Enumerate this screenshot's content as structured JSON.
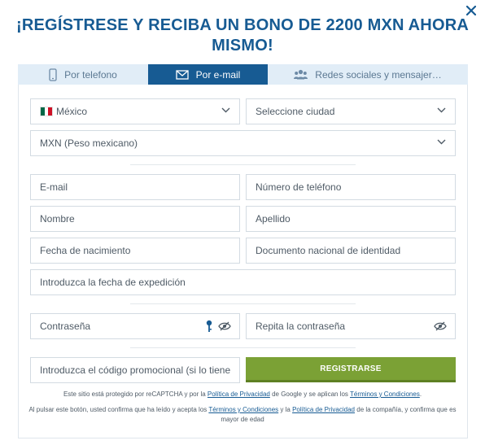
{
  "title": "¡REGÍSTRESE Y RECIBA UN BONO DE 2200 MXN AHORA MISMO!",
  "tabs": [
    {
      "label": "Por telefono",
      "icon": "phone-icon"
    },
    {
      "label": "Por e-mail",
      "icon": "envelope-icon",
      "active": true
    },
    {
      "label": "Redes sociales y mensajer…",
      "icon": "users-icon"
    }
  ],
  "form": {
    "country": "México",
    "city": "Seleccione ciudad",
    "currency": "MXN (Peso mexicano)",
    "email": "E-mail",
    "phone": "Número de teléfono",
    "first_name": "Nombre",
    "last_name": "Apellido",
    "birth_date": "Fecha de nacimiento",
    "id_document": "Documento nacional de identidad",
    "issue_date": "Introduzca la fecha de expedición",
    "password": "Contraseña",
    "repeat_password": "Repita la contraseña",
    "promo_code": "Introduzca el código promocional (si lo tiene)",
    "register_label": "REGISTRARSE"
  },
  "legal": {
    "line1_a": "Este sitio está protegido por reCAPTCHA y por la ",
    "line1_link1": "Política de Privacidad",
    "line1_b": " de Google y se aplican los ",
    "line1_link2": "Términos y Condiciones",
    "line1_c": ".",
    "line2_a": "Al pulsar este botón, usted confirma que ha leído y acepta los ",
    "line2_link1": "Términos y Condiciones",
    "line2_b": " y la ",
    "line2_link2": "Política de Privacidad",
    "line2_c": " de la compañía, y confirma que es mayor de edad"
  },
  "colors": {
    "primary": "#175b93",
    "tab_bg": "#e1edf7",
    "button": "#7ba135",
    "flag_green": "#006847",
    "flag_red": "#ce1126"
  }
}
